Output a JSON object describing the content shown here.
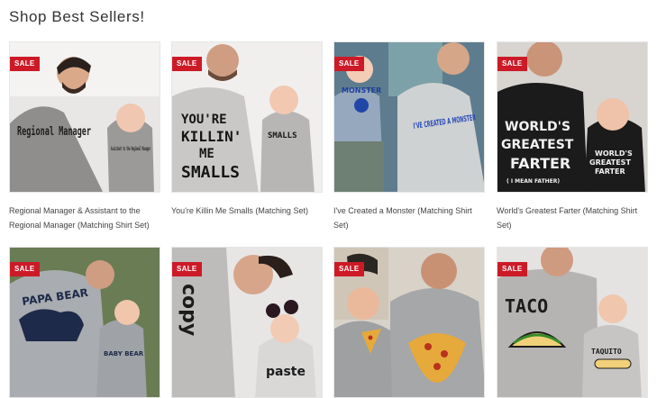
{
  "section": {
    "title": "Shop Best Sellers!"
  },
  "products": [
    {
      "badge": "SALE",
      "caption": "Regional Manager & Assistant to the Regional Manager (Matching Shirt Set)",
      "shirt_text_adult": "Regional Manager",
      "shirt_text_baby": "Assistant to the Regional Manager"
    },
    {
      "badge": "SALE",
      "caption": "You're Killin Me Smalls (Matching Set)",
      "shirt_text_adult": "YOU'RE KILLIN' ME SMALLS",
      "shirt_text_baby": "SMALLS"
    },
    {
      "badge": "SALE",
      "caption": "I've Created a Monster (Matching Shirt Set)",
      "shirt_text_adult": "I'VE CREATED A MONSTER",
      "shirt_text_baby": "MONSTER"
    },
    {
      "badge": "SALE",
      "caption": "World's Greatest Farter (Matching Shirt Set)",
      "shirt_text_adult": "WORLD'S GREATEST FARTER (I MEAN FATHER)",
      "shirt_text_baby": "WORLD'S GREATEST FARTER"
    },
    {
      "badge": "SALE",
      "shirt_text_adult": "PAPA BEAR",
      "shirt_text_baby": "BABY BEAR"
    },
    {
      "badge": "SALE",
      "shirt_text_adult": "copy",
      "shirt_text_baby": "paste"
    },
    {
      "badge": "SALE"
    },
    {
      "badge": "SALE",
      "shirt_text_adult": "TACO",
      "shirt_text_baby": "TAQUITO"
    }
  ]
}
